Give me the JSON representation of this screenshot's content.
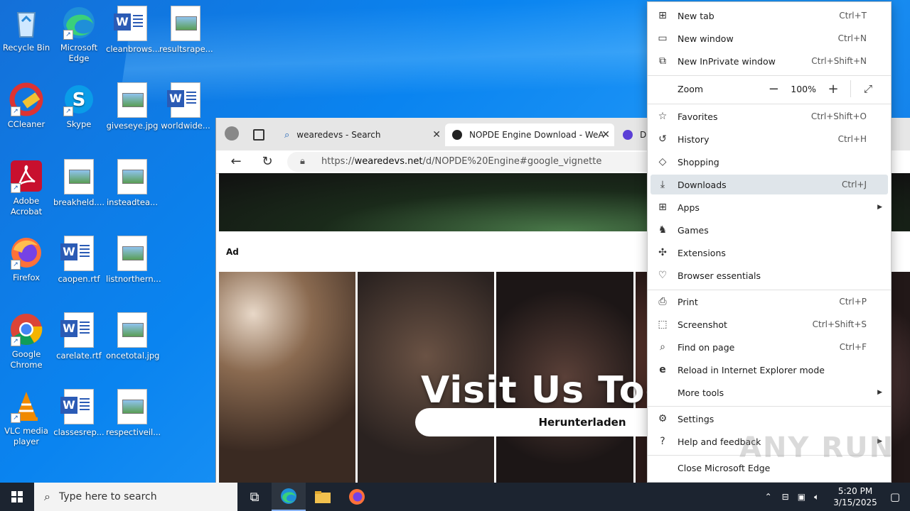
{
  "desktop": {
    "icons": [
      {
        "label": "Recycle Bin"
      },
      {
        "label": "Microsoft Edge"
      },
      {
        "label": "cleanbrows..."
      },
      {
        "label": "resultsrape..."
      },
      {
        "label": "CCleaner"
      },
      {
        "label": "Skype"
      },
      {
        "label": "giveseye.jpg"
      },
      {
        "label": "worldwide..."
      },
      {
        "label": "Adobe Acrobat"
      },
      {
        "label": "breakheld...."
      },
      {
        "label": "insteadtea..."
      },
      {
        "label": "Firefox"
      },
      {
        "label": "caopen.rtf"
      },
      {
        "label": "listnorthern..."
      },
      {
        "label": "Google Chrome"
      },
      {
        "label": "carelate.rtf"
      },
      {
        "label": "oncetotal.jpg"
      },
      {
        "label": "VLC media player"
      },
      {
        "label": "classesrep..."
      },
      {
        "label": "respectiveil..."
      }
    ]
  },
  "browser": {
    "tabs": [
      {
        "label": "wearedevs - Search"
      },
      {
        "label": "NOPDE Engine Download - WeA"
      },
      {
        "label": "D"
      }
    ],
    "url_prefix": "https://",
    "url_host": "wearedevs.net",
    "url_path": "/d/NOPDE%20Engine#google_vignette",
    "page": {
      "ad_label": "Ad",
      "headline": "Visit Us Tod",
      "download_button": "Herunterladen"
    }
  },
  "menu": {
    "items": [
      {
        "label": "New tab",
        "shortcut": "Ctrl+T",
        "icon": "new-tab-icon"
      },
      {
        "label": "New window",
        "shortcut": "Ctrl+N",
        "icon": "window-icon"
      },
      {
        "label": "New InPrivate window",
        "shortcut": "Ctrl+Shift+N",
        "icon": "inprivate-icon"
      },
      {
        "label": "Favorites",
        "shortcut": "Ctrl+Shift+O",
        "icon": "star-icon"
      },
      {
        "label": "History",
        "shortcut": "Ctrl+H",
        "icon": "history-icon"
      },
      {
        "label": "Shopping",
        "shortcut": "",
        "icon": "tag-icon"
      },
      {
        "label": "Downloads",
        "shortcut": "Ctrl+J",
        "icon": "download-icon"
      },
      {
        "label": "Apps",
        "shortcut": "",
        "icon": "apps-icon"
      },
      {
        "label": "Games",
        "shortcut": "",
        "icon": "games-icon"
      },
      {
        "label": "Extensions",
        "shortcut": "",
        "icon": "puzzle-icon"
      },
      {
        "label": "Browser essentials",
        "shortcut": "",
        "icon": "heart-icon"
      },
      {
        "label": "Print",
        "shortcut": "Ctrl+P",
        "icon": "print-icon"
      },
      {
        "label": "Screenshot",
        "shortcut": "Ctrl+Shift+S",
        "icon": "screenshot-icon"
      },
      {
        "label": "Find on page",
        "shortcut": "Ctrl+F",
        "icon": "find-icon"
      },
      {
        "label": "Reload in Internet Explorer mode",
        "shortcut": "",
        "icon": "ie-icon"
      },
      {
        "label": "More tools",
        "shortcut": "",
        "icon": ""
      },
      {
        "label": "Settings",
        "shortcut": "",
        "icon": "gear-icon"
      },
      {
        "label": "Help and feedback",
        "shortcut": "",
        "icon": "help-icon"
      },
      {
        "label": "Close Microsoft Edge",
        "shortcut": "",
        "icon": ""
      }
    ],
    "zoom_label": "Zoom",
    "zoom_value": "100%",
    "zoom_minus": "−",
    "zoom_plus": "+"
  },
  "watermark": "ANY RUN",
  "taskbar": {
    "search_placeholder": "Type here to search",
    "time": "5:20 PM",
    "date": "3/15/2025"
  }
}
